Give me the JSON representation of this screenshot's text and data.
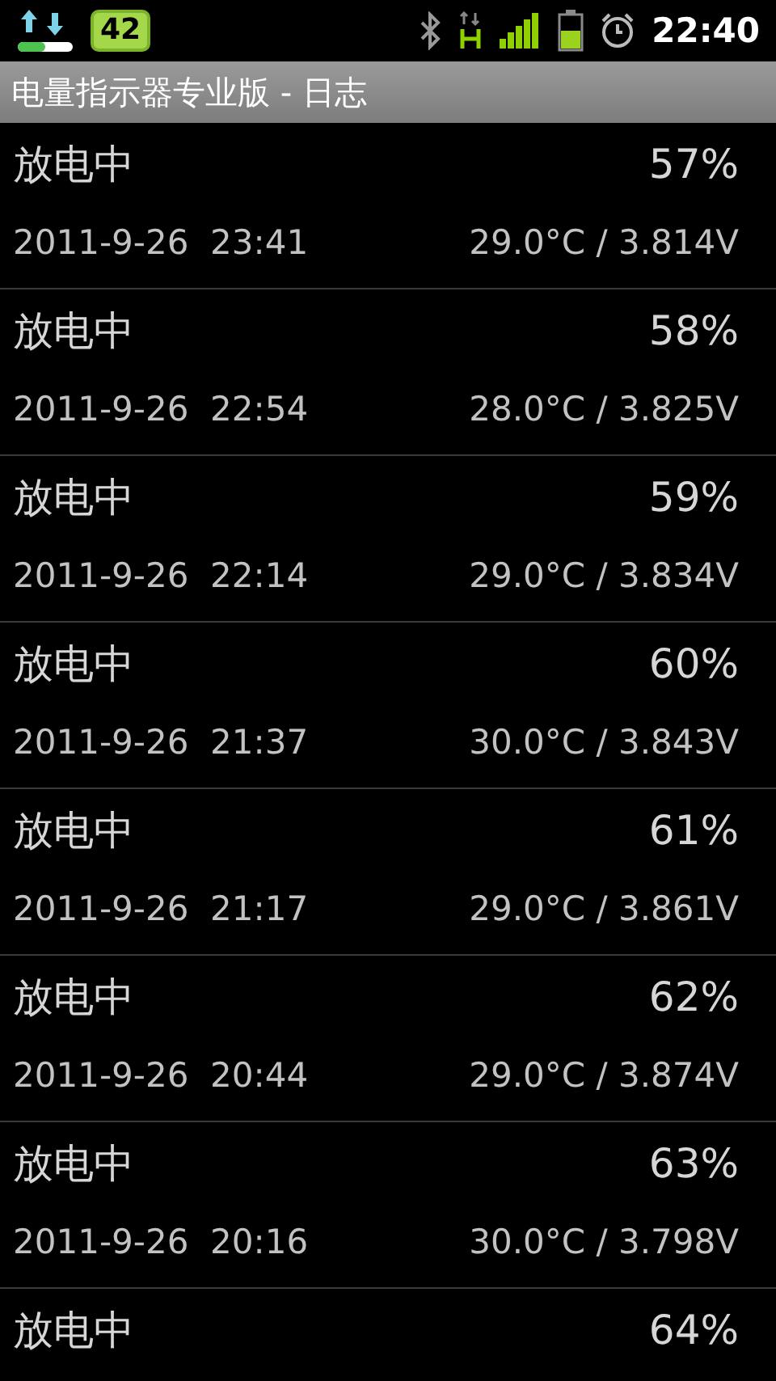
{
  "status_bar": {
    "notification_count": "42",
    "time": "22:40"
  },
  "title": "电量指示器专业版 - 日志",
  "entries": [
    {
      "status": "放电中",
      "percent": "57%",
      "datetime": "2011-9-26  23:41",
      "reading": "29.0°C / 3.814V"
    },
    {
      "status": "放电中",
      "percent": "58%",
      "datetime": "2011-9-26  22:54",
      "reading": "28.0°C / 3.825V"
    },
    {
      "status": "放电中",
      "percent": "59%",
      "datetime": "2011-9-26  22:14",
      "reading": "29.0°C / 3.834V"
    },
    {
      "status": "放电中",
      "percent": "60%",
      "datetime": "2011-9-26  21:37",
      "reading": "30.0°C / 3.843V"
    },
    {
      "status": "放电中",
      "percent": "61%",
      "datetime": "2011-9-26  21:17",
      "reading": "29.0°C / 3.861V"
    },
    {
      "status": "放电中",
      "percent": "62%",
      "datetime": "2011-9-26  20:44",
      "reading": "29.0°C / 3.874V"
    },
    {
      "status": "放电中",
      "percent": "63%",
      "datetime": "2011-9-26  20:16",
      "reading": "30.0°C / 3.798V"
    },
    {
      "status": "放电中",
      "percent": "64%"
    }
  ]
}
